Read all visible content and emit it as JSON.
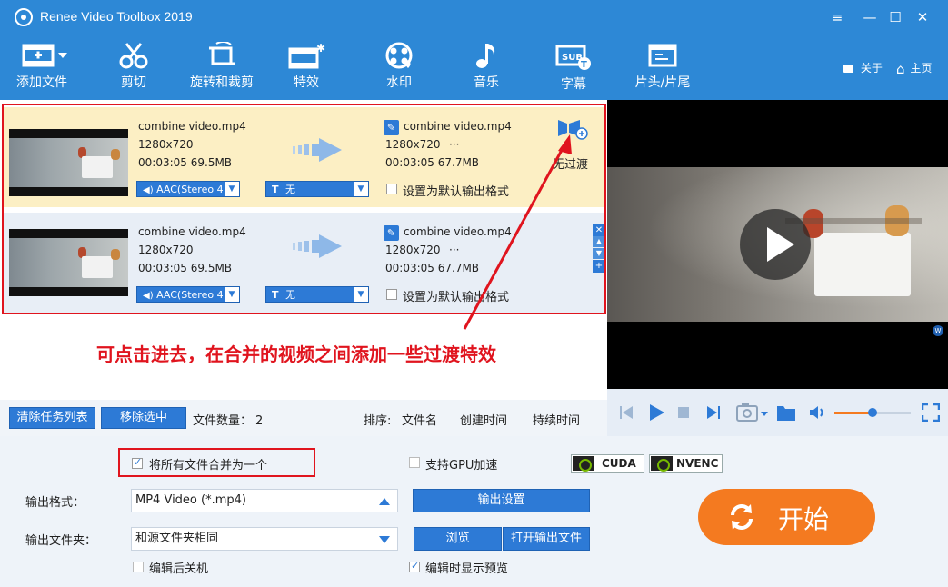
{
  "window": {
    "title": "Renee Video Toolbox 2019",
    "controls": [
      "≡",
      "—",
      "☐",
      "✕"
    ]
  },
  "toolbar": {
    "items": [
      {
        "label": "添加文件",
        "icon": "add-file-icon"
      },
      {
        "label": "剪切",
        "icon": "scissors-icon"
      },
      {
        "label": "旋转和裁剪",
        "icon": "rotate-crop-icon"
      },
      {
        "label": "特效",
        "icon": "effects-icon"
      },
      {
        "label": "水印",
        "icon": "watermark-icon"
      },
      {
        "label": "音乐",
        "icon": "music-icon"
      },
      {
        "label": "字幕",
        "icon": "subtitle-icon"
      },
      {
        "label": "片头/片尾",
        "icon": "intro-outro-icon"
      }
    ],
    "about_label": "关于",
    "home_label": "主页"
  },
  "tasks": [
    {
      "src_name": "combine video.mp4",
      "src_res": "1280x720",
      "src_duration": "00:03:05",
      "src_size": "69.5MB",
      "out_name": "combine video.mp4",
      "out_res": "1280x720",
      "out_more": "···",
      "out_duration": "00:03:05",
      "out_size": "67.7MB",
      "audio": "AAC(Stereo 4",
      "subtitle": "无",
      "default_format_label": "设置为默认输出格式",
      "transition_label": "无过渡"
    },
    {
      "src_name": "combine video.mp4",
      "src_res": "1280x720",
      "src_duration": "00:03:05",
      "src_size": "69.5MB",
      "out_name": "combine video.mp4",
      "out_res": "1280x720",
      "out_more": "···",
      "out_duration": "00:03:05",
      "out_size": "67.7MB",
      "audio": "AAC(Stereo 4",
      "subtitle": "无",
      "default_format_label": "设置为默认输出格式"
    }
  ],
  "annotation": "可点击进去，在合并的视频之间添加一些过渡特效",
  "list_footer": {
    "clear_label": "清除任务列表",
    "remove_label": "移除选中",
    "count_label": "文件数量：",
    "count_value": "2",
    "sort_label": "排序:",
    "sort_name": "文件名",
    "sort_created": "创建时间",
    "sort_duration": "持续时间"
  },
  "preview": {
    "volume_level": 0.5
  },
  "settings": {
    "merge_label": "将所有文件合并为一个",
    "merge_checked": true,
    "gpu_label": "支持GPU加速",
    "gpu_checked": false,
    "cuda_label": "CUDA",
    "nvenc_label": "NVENC",
    "format_label": "输出格式：",
    "format_value": "MP4 Video (*.mp4)",
    "output_settings_label": "输出设置",
    "folder_label": "输出文件夹：",
    "folder_value": "和源文件夹相同",
    "browse_label": "浏览",
    "open_folder_label": "打开输出文件",
    "shutdown_label": "编辑后关机",
    "shutdown_checked": false,
    "show_preview_label": "编辑时显示预览",
    "show_preview_checked": true,
    "start_label": "开始"
  },
  "colors": {
    "accent": "#2d88d6",
    "selected_row": "#fcefc4",
    "start_button": "#f47a20",
    "annotation_red": "#e0141e"
  }
}
